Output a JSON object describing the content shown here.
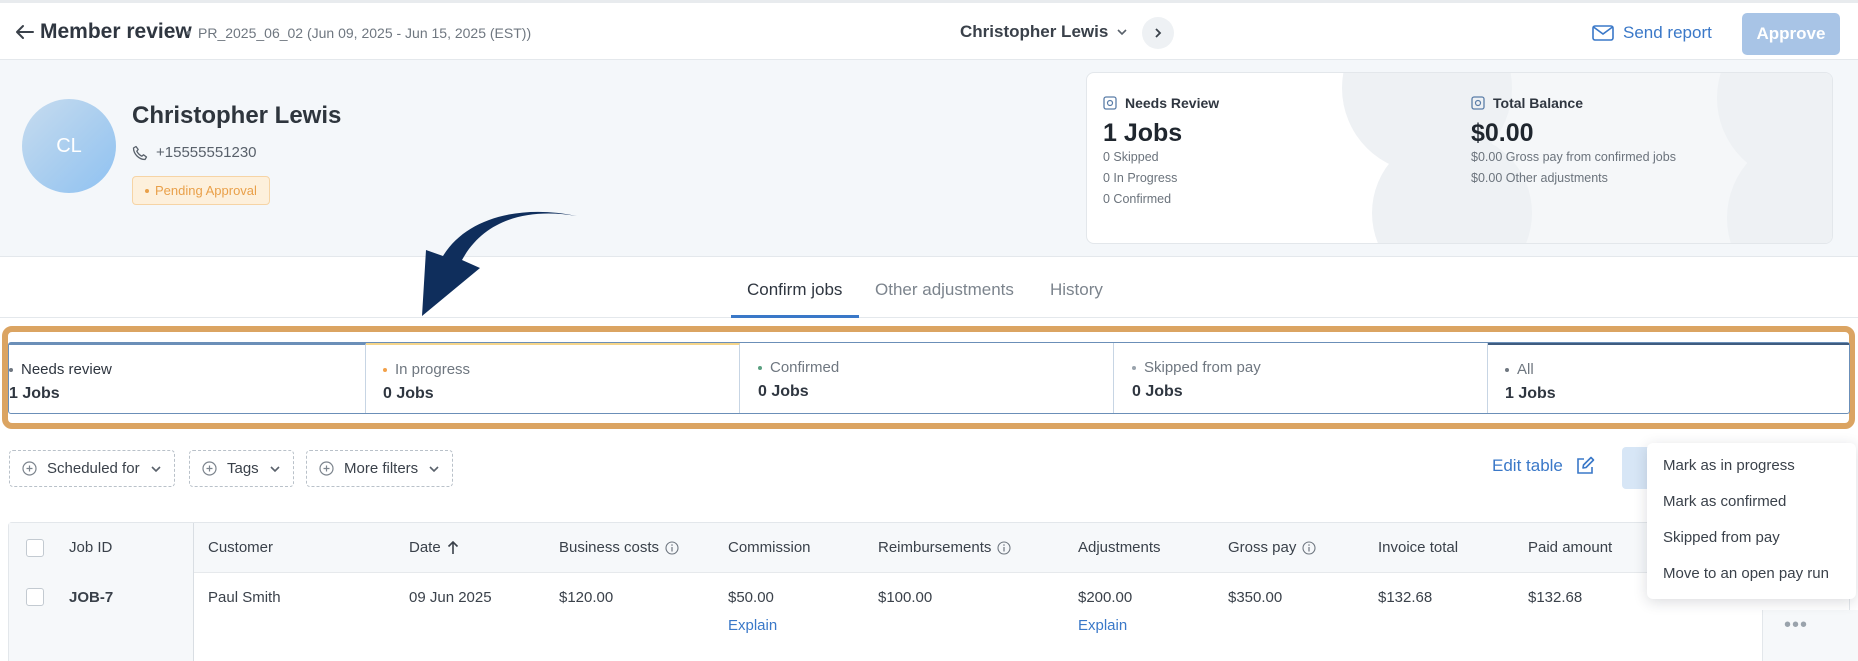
{
  "header": {
    "title": "Member review",
    "separator": "•",
    "period": "PR_2025_06_02 (Jun 09, 2025 - Jun 15, 2025 (EST))",
    "member_select": "Christopher Lewis",
    "send_report": "Send report",
    "approve": "Approve"
  },
  "profile": {
    "initials": "CL",
    "name": "Christopher Lewis",
    "phone": "+15555551230",
    "status": "Pending Approval"
  },
  "summary": {
    "needs_review": {
      "title": "Needs Review",
      "value": "1 Jobs",
      "lines": [
        "0 Skipped",
        "0 In Progress",
        "0 Confirmed"
      ]
    },
    "total_balance": {
      "title": "Total Balance",
      "value": "$0.00",
      "lines": [
        "$0.00 Gross pay from confirmed jobs",
        "$0.00 Other adjustments"
      ]
    }
  },
  "tabs": [
    "Confirm jobs",
    "Other adjustments",
    "History"
  ],
  "status_cards": [
    {
      "label": "Needs review",
      "value": "1 Jobs",
      "dot_color": "#4d5660"
    },
    {
      "label": "In progress",
      "value": "0 Jobs",
      "dot_color": "#f2a14a"
    },
    {
      "label": "Confirmed",
      "value": "0 Jobs",
      "dot_color": "#5aa080"
    },
    {
      "label": "Skipped from pay",
      "value": "0 Jobs",
      "dot_color": "#9aa3ac"
    },
    {
      "label": "All",
      "value": "1 Jobs",
      "dot_color": "#4d5660"
    }
  ],
  "filters": [
    "Scheduled for",
    "Tags",
    "More filters"
  ],
  "edit_table": "Edit table",
  "table": {
    "headers": [
      "Job ID",
      "Customer",
      "Date",
      "Business costs",
      "Commission",
      "Reimbursements",
      "Adjustments",
      "Gross pay",
      "Invoice total",
      "Paid amount"
    ],
    "row": {
      "job_id": "JOB-7",
      "customer": "Paul Smith",
      "date": "09 Jun 2025",
      "business_costs": "$120.00",
      "commission": "$50.00",
      "commission_link": "Explain",
      "reimbursements": "$100.00",
      "adjustments": "$200.00",
      "adjustments_link": "Explain",
      "gross_pay": "$350.00",
      "invoice_total": "$132.68",
      "paid_amount": "$132.68",
      "more": "•••"
    }
  },
  "menu": [
    "Mark as in progress",
    "Mark as confirmed",
    "Skipped from pay",
    "Move to an open pay run"
  ],
  "colors": {
    "accent": "#3a78c8",
    "highlight_frame": "#dba462",
    "pending": "#e9a04a",
    "arrow": "#0f2e5c"
  }
}
